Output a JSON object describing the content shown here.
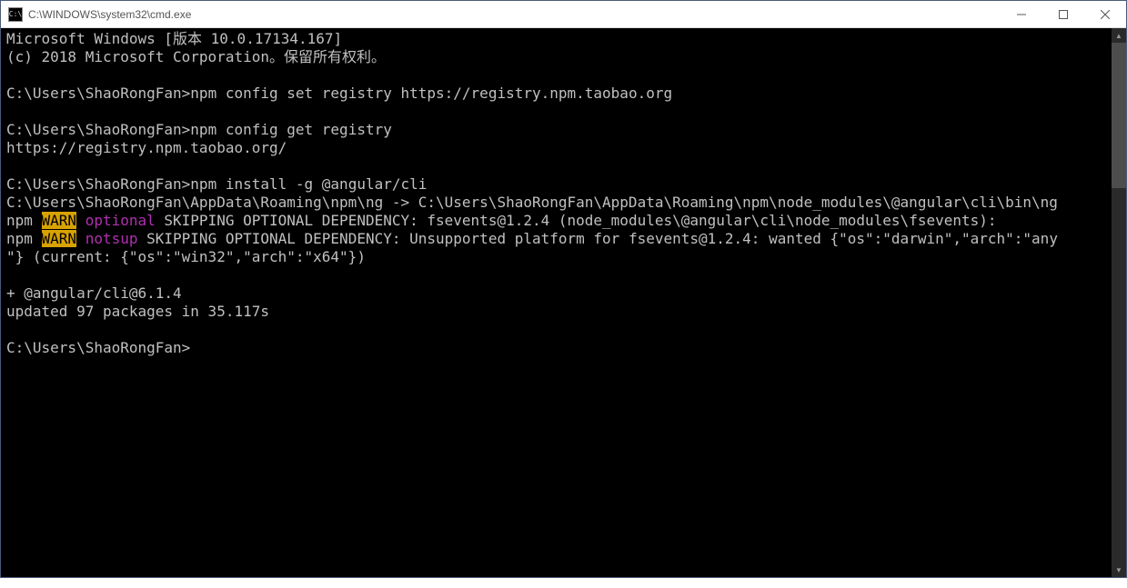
{
  "titlebar": {
    "icon_text": "C:\\",
    "title": "C:\\WINDOWS\\system32\\cmd.exe"
  },
  "terminal": {
    "line1": "Microsoft Windows [版本 10.0.17134.167]",
    "line2": "(c) 2018 Microsoft Corporation。保留所有权利。",
    "blank1": "",
    "prompt1": "C:\\Users\\ShaoRongFan>",
    "cmd1": "npm config set registry https://registry.npm.taobao.org",
    "blank2": "",
    "prompt2": "C:\\Users\\ShaoRongFan>",
    "cmd2": "npm config get registry",
    "out2": "https://registry.npm.taobao.org/",
    "blank3": "",
    "prompt3": "C:\\Users\\ShaoRongFan>",
    "cmd3": "npm install -g @angular/cli",
    "out3a": "C:\\Users\\ShaoRongFan\\AppData\\Roaming\\npm\\ng -> C:\\Users\\ShaoRongFan\\AppData\\Roaming\\npm\\node_modules\\@angular\\cli\\bin\\ng",
    "warn1_prefix": "npm ",
    "warn1_badge": "WARN",
    "warn1_sp": " ",
    "warn1_reason": "optional",
    "warn1_rest": " SKIPPING OPTIONAL DEPENDENCY: fsevents@1.2.4 (node_modules\\@angular\\cli\\node_modules\\fsevents):",
    "warn2_prefix": "npm ",
    "warn2_badge": "WARN",
    "warn2_sp": " ",
    "warn2_reason": "notsup",
    "warn2_rest_a": " SKIPPING OPTIONAL DEPENDENCY: Unsupported platform for fsevents@1.2.4: wanted {\"os\":\"darwin\",\"arch\":\"any",
    "warn2_rest_b": "\"} (current: {\"os\":\"win32\",\"arch\":\"x64\"})",
    "blank4": "",
    "out4": "+ @angular/cli@6.1.4",
    "out5": "updated 97 packages in 35.117s",
    "blank5": "",
    "prompt4": "C:\\Users\\ShaoRongFan>"
  }
}
